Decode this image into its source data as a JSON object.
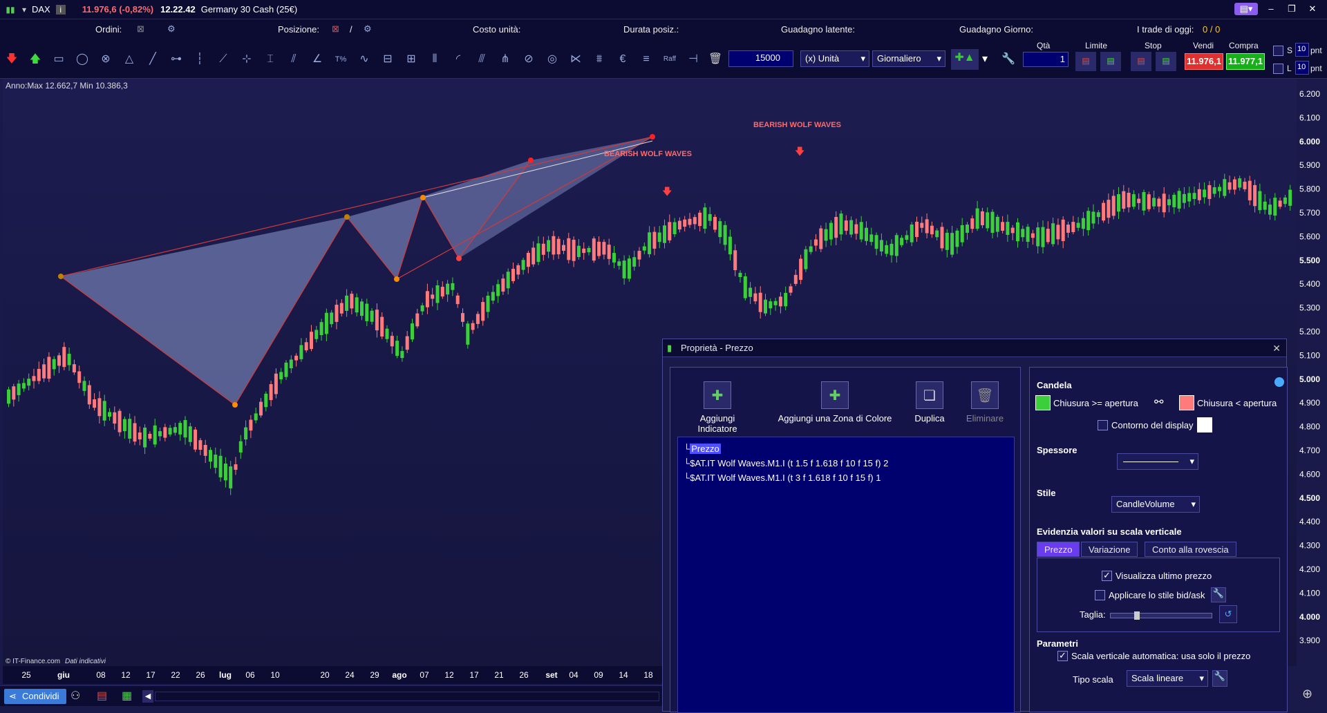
{
  "topbar": {
    "symbol": "DAX",
    "change": "11.976,6 (-0,82%)",
    "time": "12.22.42",
    "instrument": "Germany 30 Cash (25€)"
  },
  "row2": {
    "orders": "Ordini:",
    "position": "Posizione:",
    "unit_cost": "Costo unità:",
    "duration": "Durata posiz.:",
    "latent_gain": "Guadagno latente:",
    "day_gain": "Guadagno Giorno:",
    "trades_today": "I trade di oggi:",
    "trades_value": "0 / 0"
  },
  "toolbar": {
    "quantity_value": "15000",
    "unit_select": "(x) Unità",
    "period_select": "Giornaliero",
    "qta_label": "Qtà",
    "qta_value": "1",
    "limit_label": "Limite",
    "stop_label": "Stop",
    "sell_label": "Vendi",
    "buy_label": "Compra",
    "sell_price": "11.976,1",
    "buy_price": "11.977,1",
    "s_label": "S",
    "l_label": "L",
    "pnt_value_1": "10",
    "pnt_value_2": "10",
    "pnt_label_1": "pnt",
    "pnt_label_2": "pnt",
    "raff_label": "Raff"
  },
  "chart": {
    "range_label": "Anno:Max 12.662,7 Min 10.386,3",
    "credit": "© IT-Finance.com",
    "credit_note": "Dati indicativi",
    "pattern_label_1": "BEARISH WOLF WAVES",
    "pattern_label_2": "BEARISH WOLF WAVES",
    "y_ticks": [
      "6.200",
      "6.100",
      "6.000",
      "5.900",
      "5.800",
      "5.700",
      "5.600",
      "5.500",
      "5.400",
      "5.300",
      "5.200",
      "5.100",
      "5.000",
      "4.900",
      "4.800",
      "4.700",
      "4.600",
      "4.500",
      "4.400",
      "4.300",
      "4.200",
      "4.100",
      "4.000",
      "3.900"
    ],
    "x_ticks": [
      "25",
      "giu",
      "08",
      "12",
      "17",
      "22",
      "26",
      "lug",
      "06",
      "10",
      "20",
      "24",
      "29",
      "ago",
      "07",
      "12",
      "17",
      "21",
      "26",
      "set",
      "04",
      "09",
      "14",
      "18"
    ]
  },
  "statusbar": {
    "share_label": "Condividi"
  },
  "dialog": {
    "title": "Proprietà - Prezzo",
    "add_indicator": "Aggiungi Indicatore",
    "add_zone": "Aggiungi una Zona di Colore",
    "duplicate": "Duplica",
    "delete": "Eliminare",
    "tree": [
      "Prezzo",
      "$AT.IT Wolf Waves.M1.I (t 1.5 f 1.618 f 10 f 15 f) 2",
      "$AT.IT Wolf Waves.M1.I (t 3 f 1.618 f 10 f 15 f) 1"
    ],
    "candle_heading": "Candela",
    "close_up": "Chiusura >= apertura",
    "close_down": "Chiusura < apertura",
    "display_border": "Contorno del display",
    "thickness_heading": "Spessore",
    "style_heading": "Stile",
    "style_value": "CandleVolume",
    "highlight_heading": "Evidenzia valori su scala verticale",
    "tabs": [
      "Prezzo",
      "Variazione",
      "Conto alla rovescia"
    ],
    "show_last_price": "Visualizza ultimo prezzo",
    "apply_bidask": "Applicare lo stile bid/ask",
    "size_label": "Taglia:",
    "params_heading": "Parametri",
    "auto_scale": "Scala verticale automatica: usa solo il prezzo",
    "scale_type_label": "Tipo scala",
    "scale_type_value": "Scala lineare"
  },
  "colors": {
    "bull": "#3ccf3c",
    "bear": "#ff7a7a",
    "pattern_fill": "#8e9ad0",
    "pattern_line": "#d03a3a",
    "background": "#1a1a4a"
  }
}
